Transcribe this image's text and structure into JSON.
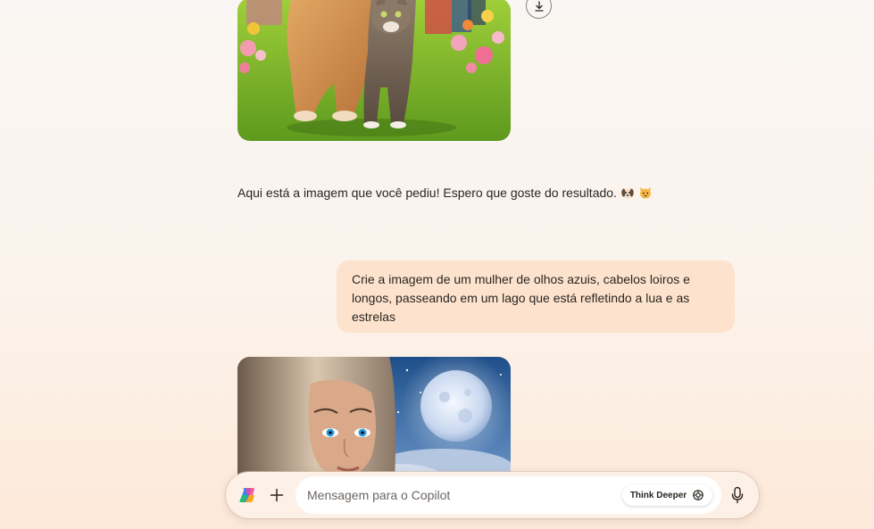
{
  "conversation": {
    "assistant_reply": "Aqui está a imagem que você pediu! Espero que goste do resultado.",
    "reply_emojis": [
      "dog-face-emoji",
      "cat-face-emoji"
    ],
    "user_prompt": "Crie a imagem de um mulher de olhos azuis, cabelos loiros e longos, passeando em um lago que está refletindo a lua e as estrelas"
  },
  "composer": {
    "placeholder": "Mensagem para o Copilot",
    "think_deeper_label": "Think Deeper"
  },
  "icons": {
    "download": "download-icon",
    "logo": "copilot-logo-icon",
    "plus": "plus-icon",
    "think": "think-deeper-icon",
    "mic": "microphone-icon"
  },
  "colors": {
    "user_bubble": "#fde3cd",
    "composer_bg": "#fdf0e6",
    "text": "#2b2520"
  }
}
